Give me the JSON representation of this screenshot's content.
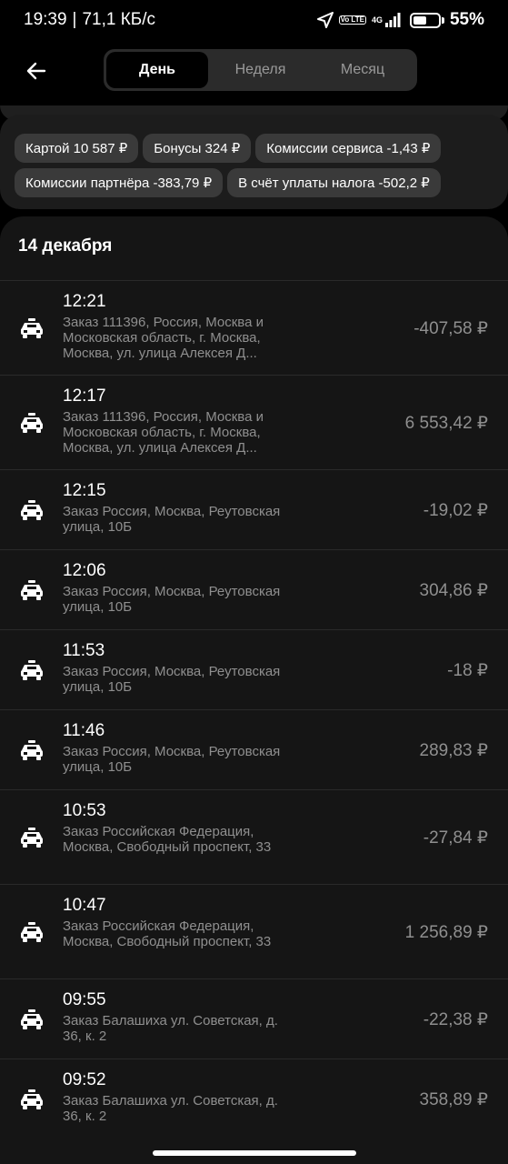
{
  "status_bar": {
    "time": "19:39",
    "network_speed": "71,1 КБ/с",
    "volte": "Vo LTE",
    "signal": "4G",
    "battery_percent": "55%",
    "battery_level": 0.55,
    "icons": [
      "location-arrow-icon",
      "volte-icon",
      "signal-4g-icon",
      "battery-icon"
    ]
  },
  "header": {
    "back_icon": "arrow-left-icon",
    "tabs": [
      {
        "label": "День",
        "active": true
      },
      {
        "label": "Неделя",
        "active": false
      },
      {
        "label": "Месяц",
        "active": false
      }
    ]
  },
  "summary": {
    "chips": [
      "Картой 10 587 ₽",
      "Бонусы 324 ₽",
      "Комиссии сервиса -1,43 ₽",
      "Комиссии партнёра -383,79 ₽",
      "В счёт уплаты налога -502,2 ₽"
    ]
  },
  "transactions": {
    "date": "14 декабря",
    "icon": "taxi-car-icon",
    "rows": [
      {
        "time": "12:21",
        "description": "Заказ 111396, Россия, Москва и Московская область, г. Москва, Москва, ул. улица Алексея Д...",
        "amount": "-407,58 ₽"
      },
      {
        "time": "12:17",
        "description": "Заказ 111396, Россия, Москва и Московская область, г. Москва, Москва, ул. улица Алексея Д...",
        "amount": "6 553,42 ₽"
      },
      {
        "time": "12:15",
        "description": "Заказ Россия, Москва, Реутовская улица, 10Б",
        "amount": "-19,02 ₽"
      },
      {
        "time": "12:06",
        "description": "Заказ Россия, Москва, Реутовская улица, 10Б",
        "amount": "304,86 ₽"
      },
      {
        "time": "11:53",
        "description": "Заказ Россия, Москва, Реутовская улица, 10Б",
        "amount": "-18 ₽"
      },
      {
        "time": "11:46",
        "description": "Заказ Россия, Москва, Реутовская улица, 10Б",
        "amount": "289,83 ₽"
      },
      {
        "time": "10:53",
        "description": "Заказ Российская Федерация, Москва, Свободный проспект, 33",
        "amount": "-27,84 ₽"
      },
      {
        "time": "10:47",
        "description": "Заказ Российская Федерация, Москва, Свободный проспект, 33",
        "amount": "1 256,89 ₽"
      },
      {
        "time": "09:55",
        "description": "Заказ Балашиха ул. Советская, д. 36, к. 2",
        "amount": "-22,38 ₽"
      },
      {
        "time": "09:52",
        "description": "Заказ Балашиха ул. Советская, д. 36, к. 2",
        "amount": "358,89 ₽"
      }
    ]
  }
}
